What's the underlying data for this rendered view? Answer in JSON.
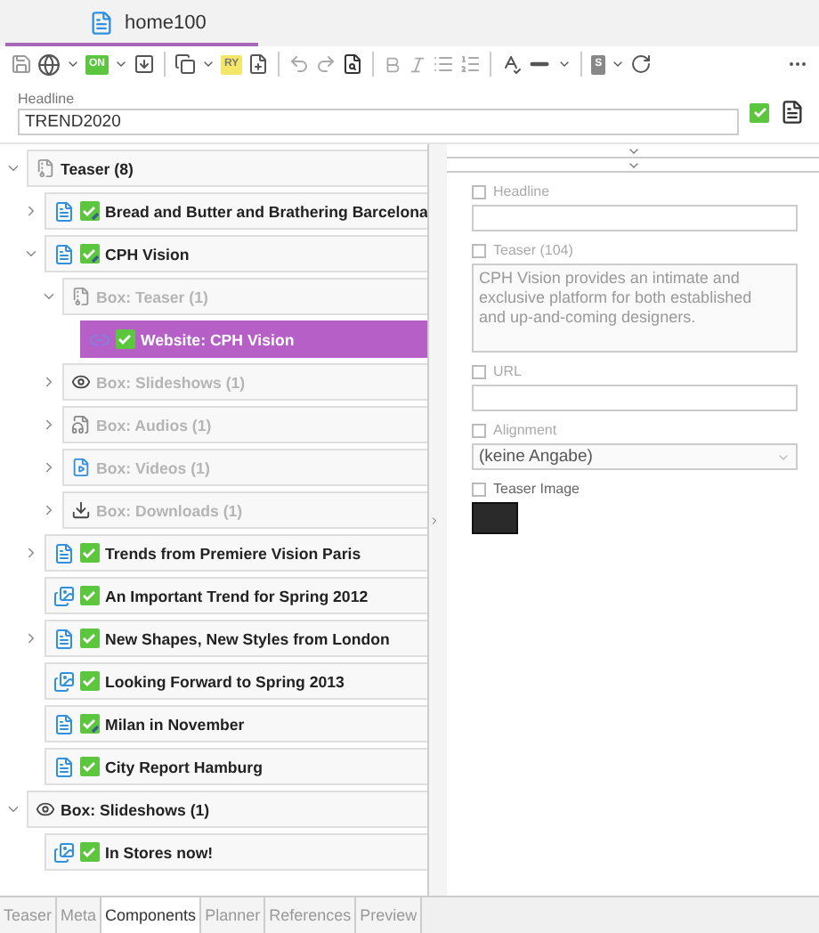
{
  "document_tab": {
    "title": "home100",
    "selected": true
  },
  "toolbar": {
    "badges": [
      "ON",
      "RY",
      "S"
    ]
  },
  "headline": {
    "label": "Headline",
    "value": "TREND2020"
  },
  "tree": [
    {
      "label": "Teaser (8)",
      "kind": "group",
      "expanded": true,
      "muted": false,
      "selected": false,
      "children": [
        {
          "label": "Bread and Butter and Brathering Barcelona",
          "kind": "article",
          "expanded": false,
          "muted": false,
          "selected": false,
          "edited": true
        },
        {
          "label": "CPH Vision",
          "kind": "article",
          "expanded": true,
          "muted": false,
          "selected": false,
          "edited": true,
          "children": [
            {
              "label": "Box: Teaser (1)",
              "kind": "group",
              "expanded": true,
              "muted": true,
              "selected": false,
              "children": [
                {
                  "label": "Website: CPH Vision",
                  "kind": "link",
                  "muted": false,
                  "selected": true,
                  "edited": false
                }
              ]
            },
            {
              "label": "Box: Slideshows (1)",
              "kind": "slideshows",
              "expanded": false,
              "muted": true,
              "selected": false
            },
            {
              "label": "Box: Audios (1)",
              "kind": "audios",
              "expanded": false,
              "muted": true,
              "selected": false
            },
            {
              "label": "Box: Videos (1)",
              "kind": "videos",
              "expanded": false,
              "muted": true,
              "selected": false
            },
            {
              "label": "Box: Downloads (1)",
              "kind": "downloads",
              "expanded": false,
              "muted": true,
              "selected": false
            }
          ]
        },
        {
          "label": "Trends from Premiere Vision Paris",
          "kind": "article",
          "expanded": false,
          "muted": false,
          "selected": false,
          "edited": false
        },
        {
          "label": "An Important Trend for Spring 2012",
          "kind": "gallery",
          "muted": false,
          "selected": false,
          "edited": false
        },
        {
          "label": "New Shapes, New Styles from London",
          "kind": "article",
          "expanded": false,
          "muted": false,
          "selected": false,
          "edited": false
        },
        {
          "label": "Looking Forward to Spring 2013",
          "kind": "gallery",
          "muted": false,
          "selected": false,
          "edited": false
        },
        {
          "label": "Milan in November",
          "kind": "article",
          "muted": false,
          "selected": false,
          "edited": true
        },
        {
          "label": "City Report Hamburg",
          "kind": "article",
          "muted": false,
          "selected": false,
          "edited": false
        }
      ]
    },
    {
      "label": "Box: Slideshows (1)",
      "kind": "slideshows",
      "expanded": true,
      "muted": false,
      "selected": false,
      "children": [
        {
          "label": "In Stores now!",
          "kind": "gallery",
          "muted": false,
          "selected": false,
          "edited": false
        }
      ]
    }
  ],
  "properties": [
    {
      "kind": "input",
      "label": "Headline",
      "checked": false
    },
    {
      "kind": "textarea",
      "label": "Teaser (104)",
      "checked": false,
      "value": "CPH Vision provides an intimate and exclusive platform for both established and up-and-coming designers."
    },
    {
      "kind": "input",
      "label": "URL",
      "checked": false
    },
    {
      "kind": "select",
      "label": "Alignment",
      "checked": false,
      "value": "(keine Angabe)"
    },
    {
      "kind": "image",
      "label": "Teaser Image",
      "checked": false
    }
  ],
  "bottom_tabs": [
    {
      "label": "Teaser",
      "selected": false
    },
    {
      "label": "Meta",
      "selected": false
    },
    {
      "label": "Components",
      "selected": true
    },
    {
      "label": "Planner",
      "selected": false
    },
    {
      "label": "References",
      "selected": false
    },
    {
      "label": "Preview",
      "selected": false
    }
  ]
}
